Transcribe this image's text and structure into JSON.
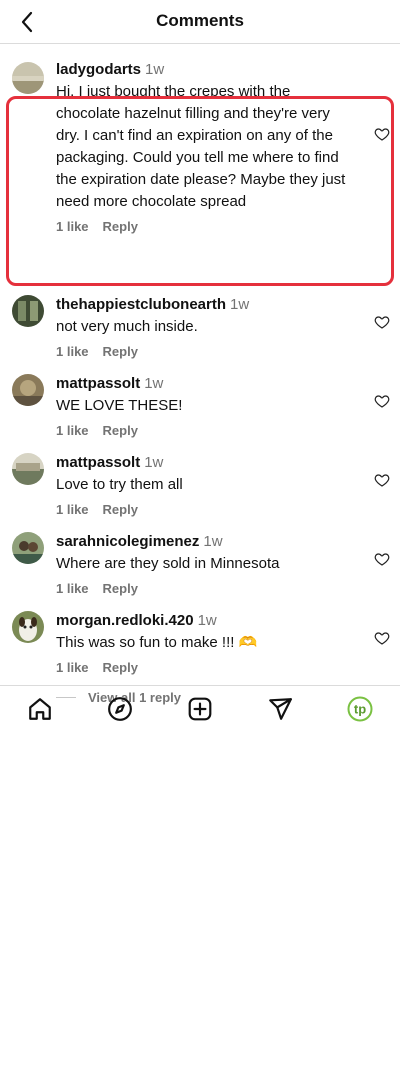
{
  "header": {
    "title": "Comments"
  },
  "comments": [
    {
      "username": "ladygodarts",
      "time": "1w",
      "text": "Hi. I just bought the crepes with the chocolate hazelnut filling and they're very dry. I can't find an expiration on any of the packaging. Could you tell me where to find the expiration date please? Maybe they just need more chocolate spread",
      "likes": "1 like",
      "reply": "Reply",
      "avatar_color": "#b9b39a"
    },
    {
      "username": "thehappiestclubonearth",
      "time": "1w",
      "text": "not very much inside.",
      "likes": "1 like",
      "reply": "Reply",
      "avatar_color": "#4c5a3c"
    },
    {
      "username": "mattpassolt",
      "time": "1w",
      "text": "WE LOVE THESE!",
      "likes": "1 like",
      "reply": "Reply",
      "avatar_color": "#8a7a5a"
    },
    {
      "username": "mattpassolt",
      "time": "1w",
      "text": "Love to try them all",
      "likes": "1 like",
      "reply": "Reply",
      "avatar_color": "#a8a592"
    },
    {
      "username": "sarahnicolegimenez",
      "time": "1w",
      "text": "Where are they sold in Minnesota",
      "likes": "1 like",
      "reply": "Reply",
      "avatar_color": "#6d7f5c"
    },
    {
      "username": "morgan.redloki.420",
      "time": "1w",
      "text": "This was so fun to make !!! 🫶",
      "likes": "1 like",
      "reply": "Reply",
      "avatar_color": "#7b8a55"
    }
  ],
  "view_replies": "View all 1 reply",
  "nav": {
    "items": [
      "home-icon",
      "explore-icon",
      "create-icon",
      "send-icon",
      "profile-icon"
    ],
    "profile_initials": "tp",
    "profile_color": "#7ac142"
  },
  "colors": {
    "highlight": "#e5303c",
    "muted": "#737373"
  }
}
